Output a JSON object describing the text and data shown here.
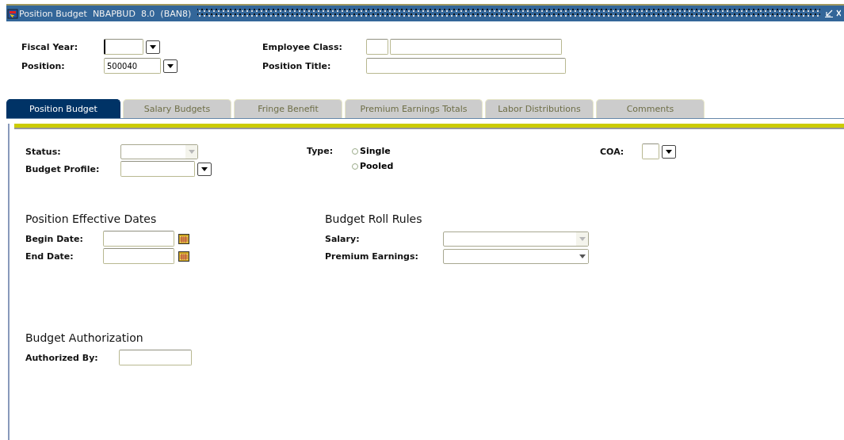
{
  "window": {
    "title": "Position Budget  NBAPBUD  8.0  (BAN8)"
  },
  "header": {
    "left": [
      {
        "label": "Fiscal Year:",
        "kind": "lov",
        "focused": true
      },
      {
        "label": "Position:",
        "kind": "lov",
        "value": "500040"
      }
    ],
    "right": [
      {
        "label": "Employee Class:",
        "kind": "pair"
      },
      {
        "label": "Position Title:",
        "kind": "text"
      }
    ]
  },
  "tabs": [
    {
      "label": "Position Budget",
      "selected": true
    },
    {
      "label": "Salary Budgets",
      "selected": false
    },
    {
      "label": "Fringe Benefit",
      "selected": false
    },
    {
      "label": "Premium Earnings Totals",
      "selected": false
    },
    {
      "label": "Labor Distributions",
      "selected": false
    },
    {
      "label": "Comments",
      "selected": false
    }
  ],
  "panel": {
    "left": [
      {
        "label": "Status:",
        "kind": "select",
        "disabled": true
      },
      {
        "label": "Budget Profile:",
        "kind": "lov"
      }
    ],
    "type": {
      "label": "Type:",
      "options": [
        {
          "label": "Single",
          "selected": false
        },
        {
          "label": "Pooled",
          "selected": false
        }
      ]
    },
    "right": [
      {
        "label": "COA:",
        "kind": "lov"
      }
    ],
    "sections": [
      {
        "title": "Position Effective Dates",
        "fields": [
          {
            "label": "Begin Date:",
            "kind": "date"
          },
          {
            "label": "End Date:",
            "kind": "date"
          }
        ]
      },
      {
        "title": "Budget Roll Rules",
        "fields": [
          {
            "label": "Salary:",
            "kind": "select",
            "disabled": true
          },
          {
            "label": "Premium Earnings:",
            "kind": "select",
            "disabled": false
          }
        ]
      },
      {
        "title": "Budget Authorization",
        "fields": [
          {
            "label": "Authorized By:",
            "kind": "text"
          }
        ]
      }
    ]
  }
}
